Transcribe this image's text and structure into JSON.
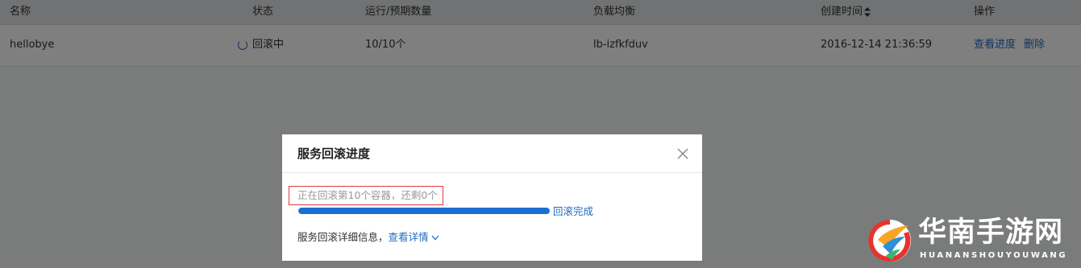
{
  "table": {
    "columns": {
      "name": "名称",
      "status": "状态",
      "run": "运行/预期数量",
      "lb": "负载均衡",
      "created": "创建时间",
      "ops": "操作"
    },
    "rows": [
      {
        "name": "hellobye",
        "status": "回滚中",
        "run": "10/10个",
        "lb": "lb-izfkfduv",
        "created": "2016-12-14 21:36:59",
        "op_progress": "查看进度",
        "op_delete": "删除"
      }
    ]
  },
  "modal": {
    "title": "服务回滚进度",
    "progress_message": "正在回滚第10个容器，还剩0个",
    "progress_percent": 100,
    "progress_status": "回滚完成",
    "detail_label": "服务回滚详细信息，",
    "detail_link": "查看详情"
  },
  "watermark": {
    "title": "华南手游网",
    "subtitle": "HUANANSHOUYOUWANG"
  },
  "colors": {
    "link": "#1f6bbf",
    "progress": "#1b6fd1",
    "highlight_border": "#e0393e"
  },
  "icons": [
    "loading-spinner-icon",
    "sort-icon",
    "close-icon",
    "chevron-down-icon",
    "logo-emblem-icon"
  ]
}
